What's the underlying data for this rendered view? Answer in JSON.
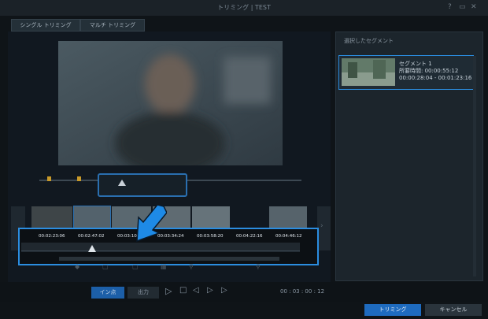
{
  "window": {
    "title": "トリミング | TEST"
  },
  "tabs": [
    {
      "label": "シングル トリミング"
    },
    {
      "label": "マルチ トリミング"
    }
  ],
  "right_panel": {
    "header": "選択したセグメント",
    "segment": {
      "name": "セグメント 1",
      "duration_line": "所要時間: 00:00:55:12",
      "range_line": "00:00:28:04 - 00:01:23:16"
    }
  },
  "ruler": {
    "ticks": [
      "00:02:23:06",
      "00:02:47:02",
      "00:03:10:2",
      "00:03:34:24",
      "00:03:58:20",
      "00:04:22:16",
      "00:04:46:12"
    ]
  },
  "playback": {
    "mark_in_label": "イン点",
    "mark_out_label": "出力",
    "timecode": "00 : 03 : 00 : 12"
  },
  "footer": {
    "trim_label": "トリミング",
    "cancel_label": "キャンセル"
  },
  "colors": {
    "highlight": "#2b8de0",
    "accent": "#1e6bbf"
  }
}
